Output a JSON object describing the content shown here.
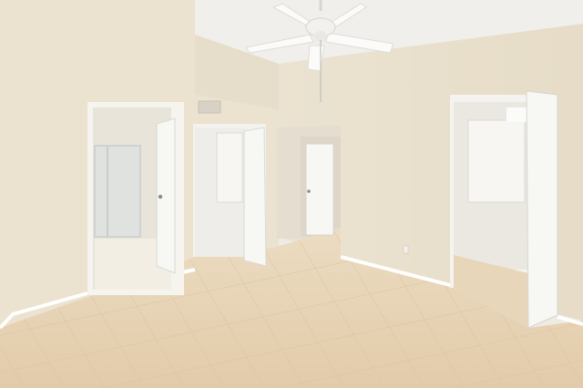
{
  "photo": {
    "subject": "",
    "colors": {
      "wall": "#ece4d2",
      "wall_shade": "#e2d8c2",
      "ceiling": "#f1efec",
      "floor": "#e6d2b4",
      "floor_grout": "#d8c2a2",
      "door": "#f7f7f4",
      "baseboard": "#ffffff",
      "closet_interior": "#f0eeea",
      "shower_glass": "#e4e7e6"
    }
  }
}
